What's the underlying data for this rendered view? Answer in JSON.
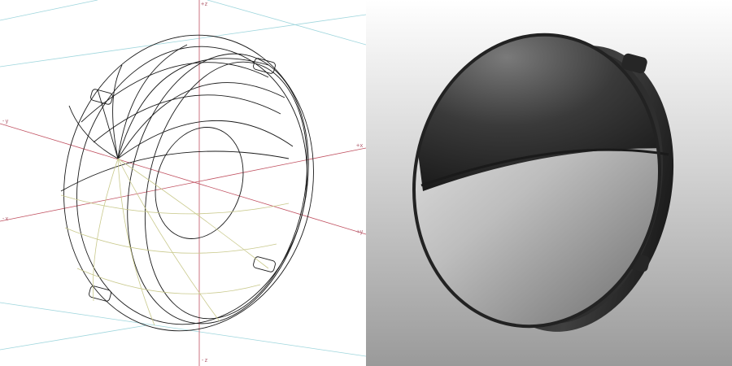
{
  "wireframe_view": {
    "axis_labels": {
      "z_top": "+z",
      "z_bottom": "-z",
      "y_left": "-y",
      "y_right": "+y",
      "x_left": "-x",
      "x_right": "+x"
    }
  },
  "render_view": {},
  "colors": {
    "wire": "#1a1a1a",
    "wire_secondary": "#cccc99",
    "axis_red": "#c05060",
    "axis_cyan": "#9fd6dd",
    "shade_dark": "#2a2a2a",
    "shade_light": "#d8d8d8"
  }
}
